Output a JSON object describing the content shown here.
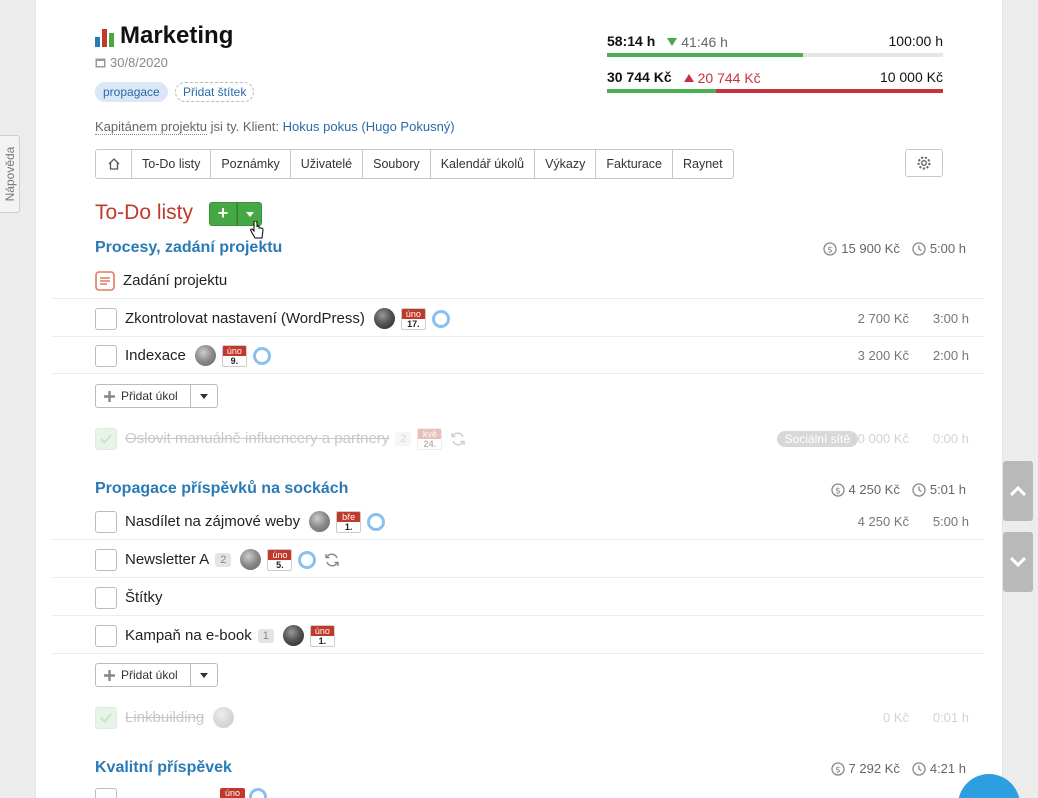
{
  "help_tab": "Nápověda",
  "project": {
    "title": "Marketing",
    "date": "30/8/2020",
    "tags": [
      "propagace"
    ],
    "add_tag": "Přidat štítek",
    "captain_label": "Kapitánem projektu",
    "captain_rest": "jsi ty. Klient:",
    "client": "Hokus pokus (Hugo Pokusný)"
  },
  "stats": {
    "time": {
      "spent": "58:14 h",
      "delta": "41:46 h",
      "budget": "100:00 h",
      "fill_fraction": 0.582
    },
    "money": {
      "spent": "30 744 Kč",
      "delta": "20 744 Kč",
      "budget": "10 000 Kč",
      "green_fraction": 0.325
    }
  },
  "tabs": [
    "To-Do listy",
    "Poznámky",
    "Uživatelé",
    "Soubory",
    "Kalendář úkolů",
    "Výkazy",
    "Fakturace",
    "Raynet"
  ],
  "section_title": "To-Do listy",
  "add_task_label": "Přidat úkol",
  "lists": [
    {
      "title": "Procesy, zadání projektu",
      "amount": "15 900 Kč",
      "time": "5:00 h",
      "note": "Zadání projektu",
      "tasks": [
        {
          "name": "Zkontrolovat nastavení (WordPress)",
          "month": "úno",
          "day": "17.",
          "amount": "2 700 Kč",
          "time": "3:00 h"
        },
        {
          "name": "Indexace",
          "month": "úno",
          "day": "9.",
          "amount": "3 200 Kč",
          "time": "2:00 h"
        }
      ],
      "done": {
        "name": "Oslovit manuálně influencery a partnery",
        "count": "2",
        "month": "kvě",
        "day": "24.",
        "tag": "Sociální sítě",
        "amount": "10 000 Kč",
        "time": "0:00 h"
      }
    },
    {
      "title": "Propagace příspěvků na sockách",
      "amount": "4 250 Kč",
      "time": "5:01 h",
      "tasks": [
        {
          "name": "Nasdílet na zájmové weby",
          "month": "bře",
          "day": "1.",
          "amount": "4 250 Kč",
          "time": "5:00 h"
        },
        {
          "name": "Newsletter A",
          "count": "2",
          "month": "úno",
          "day": "5."
        },
        {
          "name": "Štítky"
        },
        {
          "name": "Kampaň na e-book",
          "count": "1",
          "month": "úno",
          "day": "1."
        }
      ],
      "done": {
        "name": "Linkbuilding",
        "amount": "0 Kč",
        "time": "0:01 h"
      }
    },
    {
      "title": "Kvalitní příspěvek",
      "amount": "7 292 Kč",
      "time": "4:21 h",
      "tasks": [
        {
          "month": "úno"
        }
      ]
    }
  ]
}
